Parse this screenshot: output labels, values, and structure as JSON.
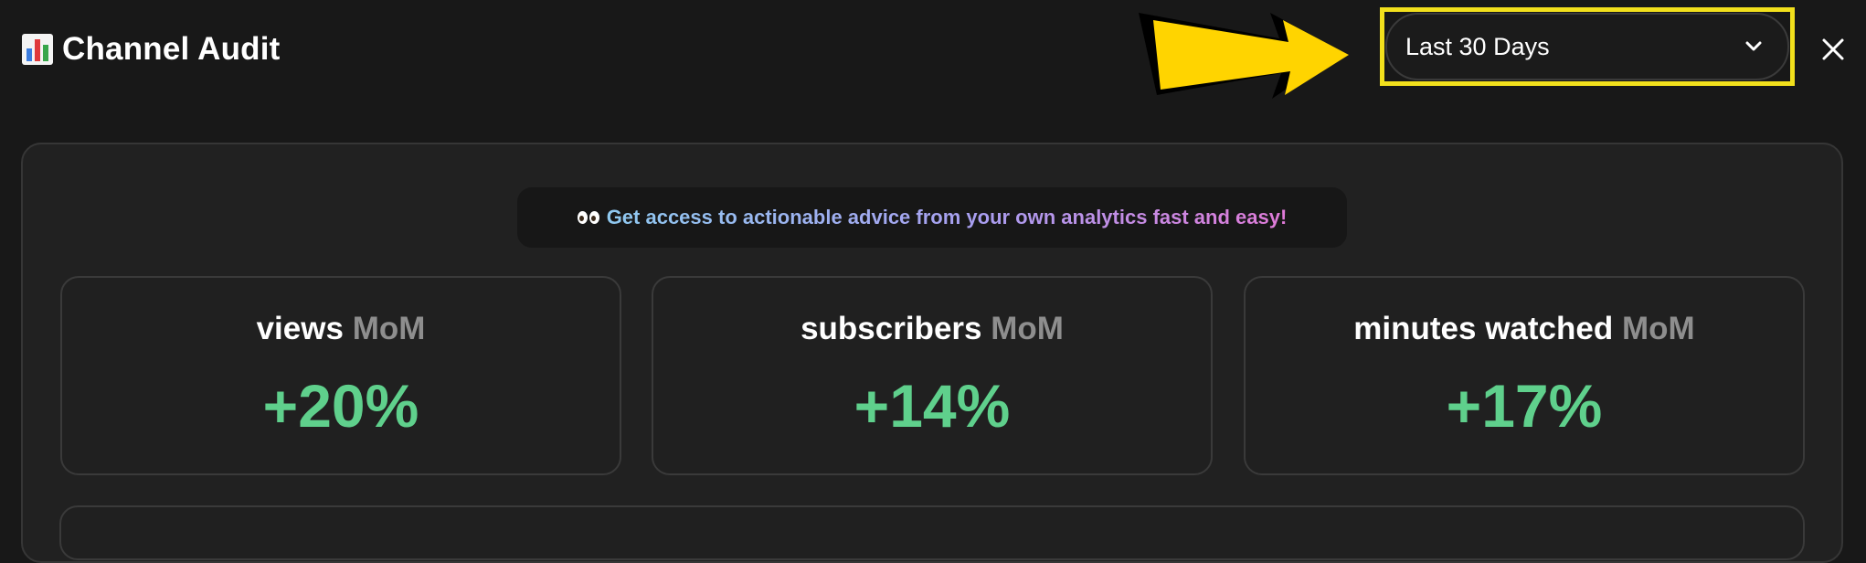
{
  "header": {
    "title": "Channel Audit",
    "title_icon": "bar-chart-icon",
    "date_range": {
      "selected": "Last 30 Days",
      "icon": "chevron-down-icon"
    },
    "close_icon": "close-icon"
  },
  "annotation": {
    "arrow_color": "#ffd400",
    "highlight_color": "#f2e01c"
  },
  "promo": {
    "icon": "eyes-icon",
    "text": "Get access to actionable advice from your own analytics fast and easy!"
  },
  "stats": [
    {
      "label": "views",
      "suffix": "MoM",
      "value": "+20%"
    },
    {
      "label": "subscribers",
      "suffix": "MoM",
      "value": "+14%"
    },
    {
      "label": "minutes watched",
      "suffix": "MoM",
      "value": "+17%"
    }
  ],
  "colors": {
    "background": "#181818",
    "panel": "#212121",
    "positive": "#5fd08c",
    "muted": "#8e8e8e"
  }
}
